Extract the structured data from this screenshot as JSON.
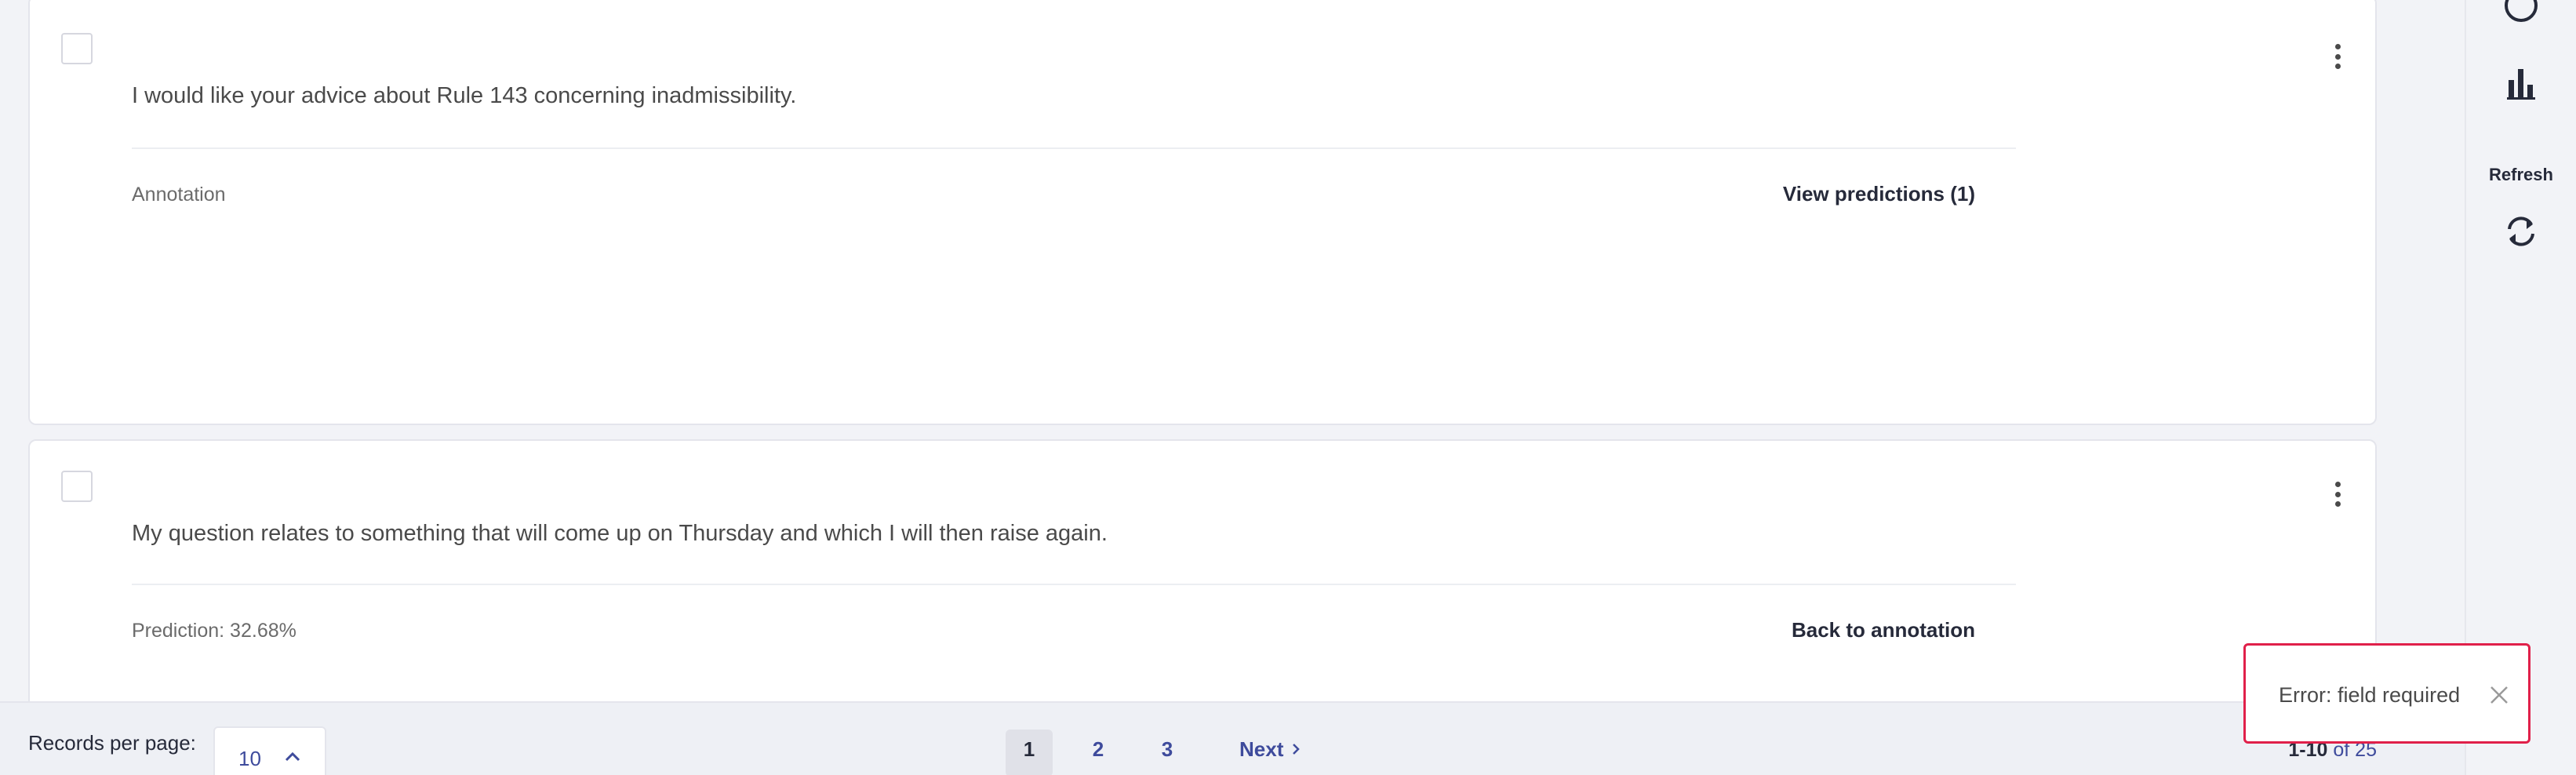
{
  "records": [
    {
      "text": "I would like your advice about Rule 143 concerning inadmissibility.",
      "meta_left": "Annotation",
      "meta_right": "View predictions (1)"
    },
    {
      "text": "My question relates to something that will come up on Thursday and which I will then raise again.",
      "meta_left": "Prediction: 32.68%",
      "meta_right": "Back to annotation"
    }
  ],
  "sidebar": {
    "icons": [
      "moon-icon",
      "bar-chart-icon",
      "refresh-icon"
    ],
    "refresh_label": "Refresh"
  },
  "footer": {
    "records_per_page_label": "Records per page:",
    "records_per_page_value": "10",
    "pages": [
      "1",
      "2",
      "3"
    ],
    "current_page": "1",
    "next_label": "Next",
    "count_range": "1-10",
    "count_of": "of 25"
  },
  "toast": {
    "message": "Error: field required"
  },
  "colors": {
    "accent": "#3e4b9c",
    "error": "#e0204a",
    "background": "#f2f3f7"
  }
}
